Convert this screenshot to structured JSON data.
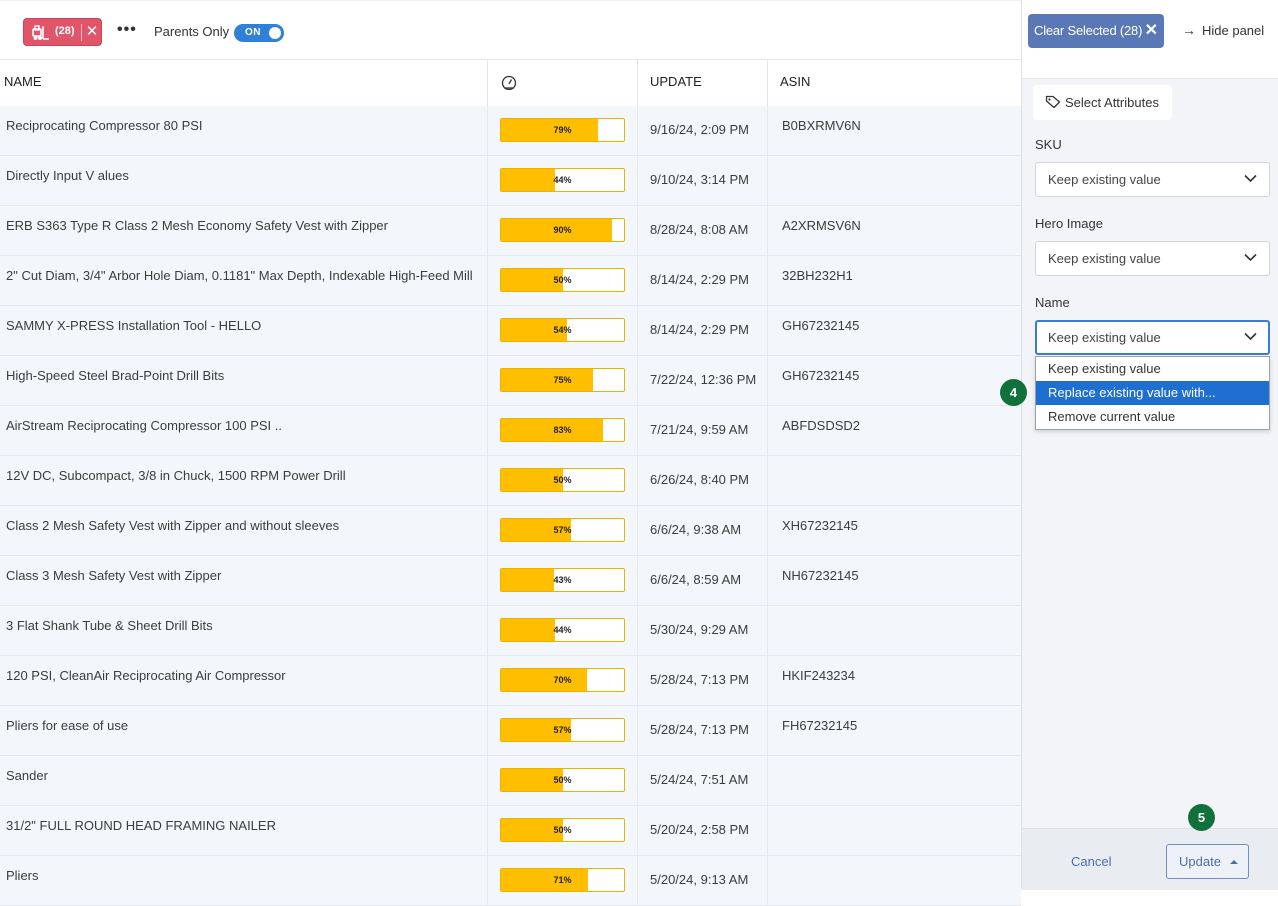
{
  "toolbar": {
    "filter_count": "(28)",
    "filter_clear": "✕",
    "more": "•••",
    "parents_only_label": "Parents Only",
    "parents_only_toggle": "ON"
  },
  "table": {
    "columns": [
      "NAME",
      "score-gauge-icon",
      "UPDATE",
      "ASIN"
    ],
    "rows": [
      {
        "name": "Reciprocating Compressor 80 PSI",
        "score": 79,
        "score_label": "79%",
        "update": "9/16/24, 2:09 PM",
        "asin": "B0BXRMV6N"
      },
      {
        "name": "Directly Input V alues",
        "score": 44,
        "score_label": "44%",
        "update": "9/10/24, 3:14 PM",
        "asin": ""
      },
      {
        "name": "ERB S363 Type R Class 2 Mesh Economy Safety Vest with Zipper",
        "score": 90,
        "score_label": "90%",
        "update": "8/28/24, 8:08 AM",
        "asin": "A2XRMSV6N"
      },
      {
        "name": "2\" Cut Diam, 3/4\" Arbor Hole Diam, 0.1181\" Max Depth, Indexable High-Feed Mill",
        "score": 50,
        "score_label": "50%",
        "update": "8/14/24, 2:29 PM",
        "asin": "32BH232H1"
      },
      {
        "name": "SAMMY X-PRESS Installation Tool - HELLO",
        "score": 54,
        "score_label": "54%",
        "update": "8/14/24, 2:29 PM",
        "asin": "GH67232145"
      },
      {
        "name": "High-Speed Steel Brad-Point Drill Bits",
        "score": 75,
        "score_label": "75%",
        "update": "7/22/24, 12:36 PM",
        "asin": "GH67232145"
      },
      {
        "name": "AirStream Reciprocating Compressor 100 PSI ..",
        "score": 83,
        "score_label": "83%",
        "update": "7/21/24, 9:59 AM",
        "asin": "ABFDSDSD2"
      },
      {
        "name": "12V DC, Subcompact, 3/8 in Chuck, 1500 RPM Power Drill",
        "score": 50,
        "score_label": "50%",
        "update": "6/26/24, 8:40 PM",
        "asin": ""
      },
      {
        "name": "Class 2 Mesh Safety Vest with Zipper and without sleeves",
        "score": 57,
        "score_label": "57%",
        "update": "6/6/24, 9:38 AM",
        "asin": "XH67232145"
      },
      {
        "name": "Class 3 Mesh Safety Vest with Zipper",
        "score": 43,
        "score_label": "43%",
        "update": "6/6/24, 8:59 AM",
        "asin": "NH67232145"
      },
      {
        "name": "3 Flat Shank Tube & Sheet Drill Bits",
        "score": 44,
        "score_label": "44%",
        "update": "5/30/24, 9:29 AM",
        "asin": ""
      },
      {
        "name": "120 PSI, CleanAir Reciprocating Air Compressor",
        "score": 70,
        "score_label": "70%",
        "update": "5/28/24, 7:13 PM",
        "asin": "HKIF243234"
      },
      {
        "name": "Pliers for ease of use",
        "score": 57,
        "score_label": "57%",
        "update": "5/28/24, 7:13 PM",
        "asin": "FH67232145"
      },
      {
        "name": "Sander",
        "score": 50,
        "score_label": "50%",
        "update": "5/24/24, 7:51 AM",
        "asin": ""
      },
      {
        "name": "31/2\" FULL ROUND HEAD FRAMING NAILER",
        "score": 50,
        "score_label": "50%",
        "update": "5/20/24, 2:58 PM",
        "asin": ""
      },
      {
        "name": "Pliers",
        "score": 71,
        "score_label": "71%",
        "update": "5/20/24, 9:13 AM",
        "asin": ""
      }
    ]
  },
  "panel": {
    "clear_selected_label": "Clear Selected (28)",
    "clear_selected_x": "✕",
    "hide_panel_label": "Hide panel",
    "select_attributes_label": "Select Attributes",
    "fields": [
      {
        "label": "SKU",
        "value": "Keep existing value"
      },
      {
        "label": "Hero Image",
        "value": "Keep existing value"
      },
      {
        "label": "Name",
        "value": "Keep existing value"
      }
    ],
    "name_options": [
      "Keep existing value",
      "Replace existing value with...",
      "Remove current value"
    ],
    "name_options_selected": "Replace existing value with...",
    "cancel_label": "Cancel",
    "update_label": "Update"
  },
  "steps": {
    "step_4": "4",
    "step_5": "5"
  },
  "colors": {
    "filter_chip": "#e0556a",
    "toggle_on": "#2f80d6",
    "score_bar": "#ffbf00",
    "clear_selected_bg": "#5b78b6",
    "option_highlight": "#1f6fd1",
    "step_badge": "#11713a"
  }
}
